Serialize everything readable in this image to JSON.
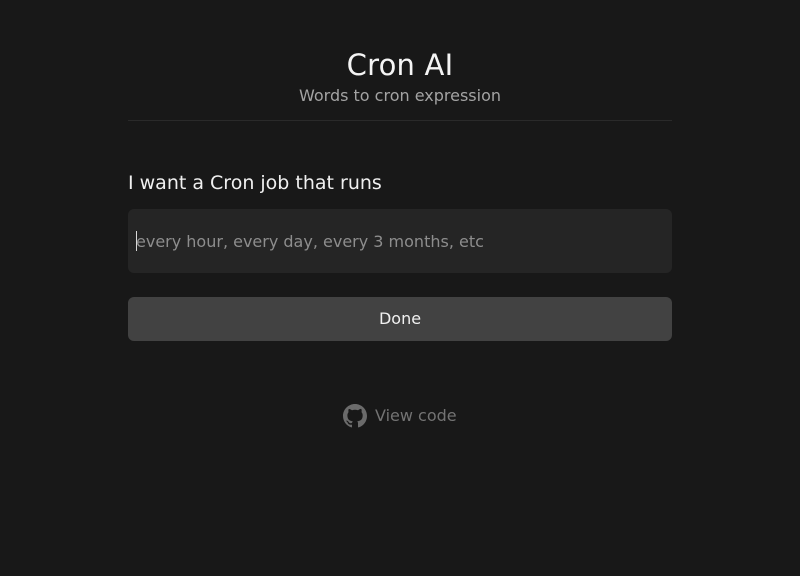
{
  "app": {
    "title": "Cron AI",
    "subtitle": "Words to cron expression"
  },
  "form": {
    "prompt_label": "I want a Cron job that runs",
    "input": {
      "value": "",
      "placeholder": "every hour, every day, every 3 months, etc"
    },
    "submit_label": "Done"
  },
  "footer": {
    "link_label": "View code",
    "icon": "github-icon"
  },
  "colors": {
    "background": "#181818",
    "input_background": "#252525",
    "button_background": "#424242",
    "title_text": "#f4f4f4",
    "subtitle_text": "#a3a3a3",
    "footer_text": "#737373"
  }
}
